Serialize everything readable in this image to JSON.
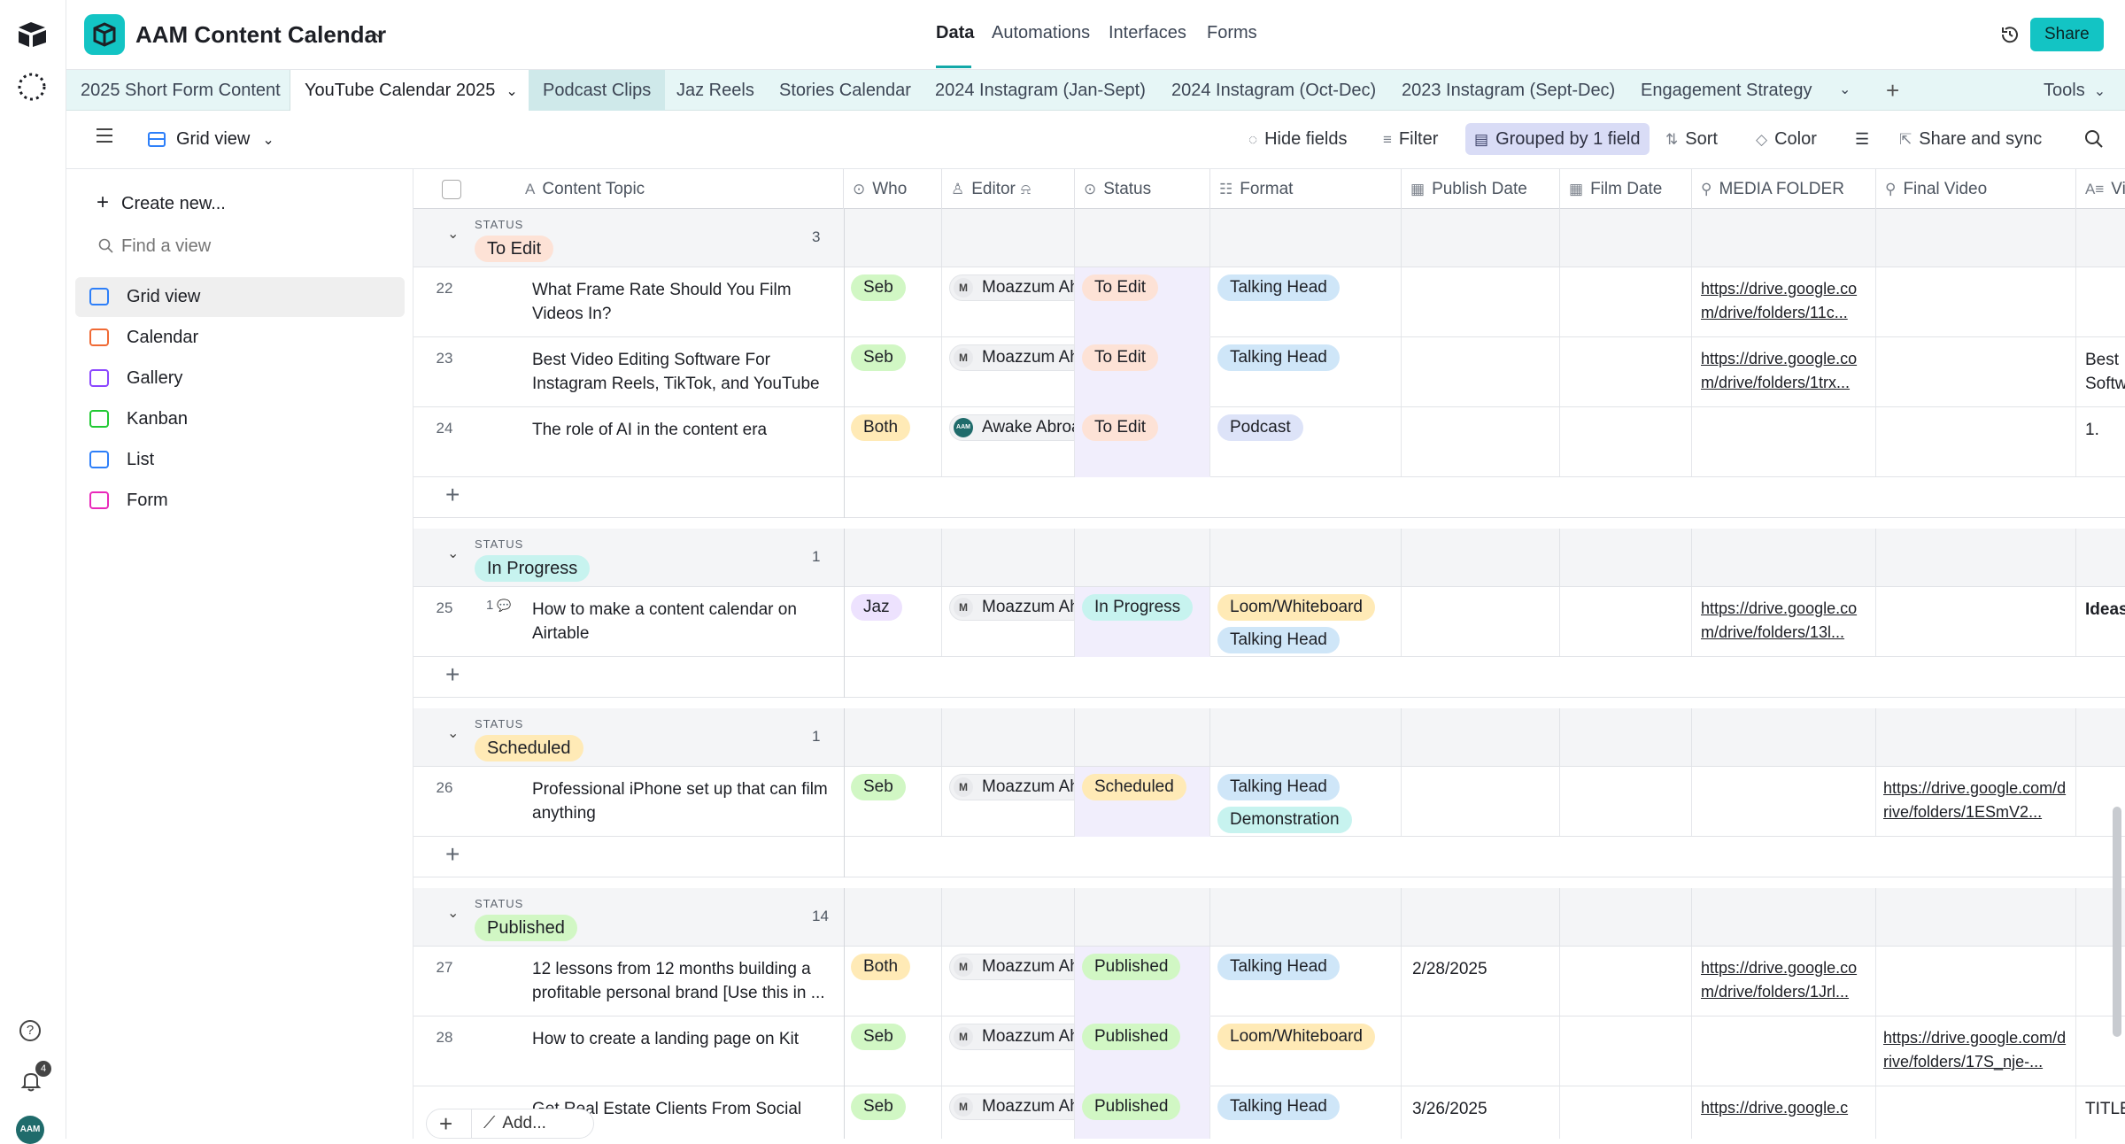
{
  "app": {
    "title": "AAM Content Calendar",
    "brand_color": "#13c4c4"
  },
  "top_nav": [
    "Data",
    "Automations",
    "Interfaces",
    "Forms"
  ],
  "share_label": "Share",
  "notifications_count": "4",
  "avatar_label": "AAM",
  "tables": [
    "2025 Short Form Content",
    "YouTube Calendar 2025",
    "Podcast Clips",
    "Jaz Reels",
    "Stories Calendar",
    "2024 Instagram (Jan-Sept)",
    "2024 Instagram (Oct-Dec)",
    "2023 Instagram (Sept-Dec)",
    "Engagement Strategy"
  ],
  "tools_label": "Tools",
  "view_name": "Grid view",
  "toolbar": {
    "hide_fields": "Hide fields",
    "filter": "Filter",
    "grouped": "Grouped by 1 field",
    "sort": "Sort",
    "color": "Color",
    "share_sync": "Share and sync"
  },
  "sidebar": {
    "create_new": "Create new...",
    "find_placeholder": "Find a view",
    "views": [
      {
        "label": "Grid view",
        "icon": "grid-icon",
        "color": "#2d7ff9"
      },
      {
        "label": "Calendar",
        "icon": "calendar-icon",
        "color": "#f06a35"
      },
      {
        "label": "Gallery",
        "icon": "gallery-icon",
        "color": "#8b46ff"
      },
      {
        "label": "Kanban",
        "icon": "kanban-icon",
        "color": "#20c933"
      },
      {
        "label": "List",
        "icon": "list-icon",
        "color": "#2d7ff9"
      },
      {
        "label": "Form",
        "icon": "form-icon",
        "color": "#e929ba"
      }
    ]
  },
  "columns": [
    "Content Topic",
    "Who",
    "Editor",
    "Status",
    "Format",
    "Publish Date",
    "Film Date",
    "MEDIA FOLDER",
    "Final Video",
    "Vi"
  ],
  "groups": [
    {
      "status_label": "STATUS",
      "name": "To Edit",
      "count": "3",
      "rows": [
        {
          "num": "22",
          "topic": "What Frame Rate Should You Film Videos In?",
          "who": "Seb",
          "editor": "Moazzum Ah",
          "editor_av": "M",
          "status": "To Edit",
          "formats": [
            "Talking Head"
          ],
          "publish": "",
          "media": "https://drive.google.com/drive/folders/11c...",
          "final": "",
          "extra": ""
        },
        {
          "num": "23",
          "topic": "Best Video Editing Software For Instagram Reels, TikTok, and YouTube ...",
          "who": "Seb",
          "editor": "Moazzum Ah",
          "editor_av": "M",
          "status": "To Edit",
          "formats": [
            "Talking Head"
          ],
          "publish": "",
          "media": "https://drive.google.com/drive/folders/1trx...",
          "final": "",
          "extra": "Best Softw"
        },
        {
          "num": "24",
          "topic": "The role of AI in the content era",
          "who": "Both",
          "editor": "Awake Abroa",
          "editor_av": "AAM",
          "status": "To Edit",
          "formats": [
            "Podcast"
          ],
          "publish": "",
          "media": "",
          "final": "",
          "extra": "1."
        }
      ]
    },
    {
      "status_label": "STATUS",
      "name": "In Progress",
      "count": "1",
      "rows": [
        {
          "num": "25",
          "comments": "1",
          "topic": "How to make a content calendar on Airtable",
          "who": "Jaz",
          "editor": "Moazzum Ah",
          "editor_av": "M",
          "status": "In Progress",
          "formats": [
            "Loom/Whiteboard",
            "Talking Head"
          ],
          "publish": "",
          "media": "https://drive.google.com/drive/folders/13l...",
          "final": "",
          "extra": "Ideas"
        }
      ]
    },
    {
      "status_label": "STATUS",
      "name": "Scheduled",
      "count": "1",
      "rows": [
        {
          "num": "26",
          "topic": "Professional iPhone set up that can film anything",
          "who": "Seb",
          "editor": "Moazzum Ah",
          "editor_av": "M",
          "status": "Scheduled",
          "formats": [
            "Talking Head",
            "Demonstration"
          ],
          "publish": "",
          "media": "",
          "final": "https://drive.google.com/drive/folders/1ESmV2...",
          "extra": ""
        }
      ]
    },
    {
      "status_label": "STATUS",
      "name": "Published",
      "count": "14",
      "rows": [
        {
          "num": "27",
          "topic": "12 lessons from 12 months building a profitable personal brand [Use this in ...",
          "who": "Both",
          "editor": "Moazzum Ah",
          "editor_av": "M",
          "status": "Published",
          "formats": [
            "Talking Head"
          ],
          "publish": "2/28/2025",
          "media": "https://drive.google.com/drive/folders/1Jrl...",
          "final": "",
          "extra": ""
        },
        {
          "num": "28",
          "topic": "How to create a landing page on Kit",
          "who": "Seb",
          "editor": "Moazzum Ah",
          "editor_av": "M",
          "status": "Published",
          "formats": [
            "Loom/Whiteboard"
          ],
          "publish": "",
          "media": "",
          "final": "https://drive.google.com/drive/folders/17S_nje-...",
          "extra": ""
        },
        {
          "num": "",
          "topic": "Get Real Estate Clients From Social",
          "who": "Seb",
          "editor": "Moazzum Ah",
          "editor_av": "M",
          "status": "Published",
          "formats": [
            "Talking Head"
          ],
          "publish": "3/26/2025",
          "media": "https://drive.google.c",
          "final": "",
          "extra": "TITLE"
        }
      ]
    }
  ],
  "bottom": {
    "add_label": "Add..."
  },
  "colors": {
    "To Edit": "#fde2d6",
    "In Progress": "#c7f3ef",
    "Scheduled": "#ffeab6",
    "Published": "#d1f7c4",
    "Seb": "#d1f7c4",
    "Both": "#ffeab6",
    "Jaz": "#ede2fe",
    "Talking Head": "#cfe6f8",
    "Podcast": "#dde3f8",
    "Loom/Whiteboard": "#ffeab6",
    "Demonstration": "#c7f3ef"
  }
}
